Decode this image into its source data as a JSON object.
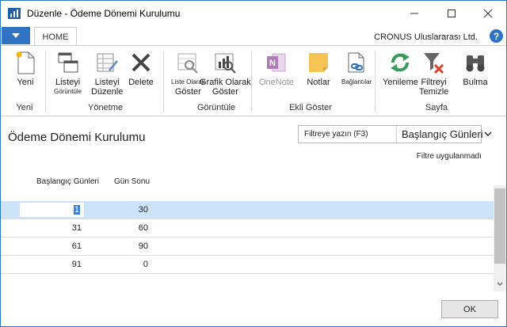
{
  "window": {
    "title": "Düzenle - Ödeme Dönemi Kurulumu",
    "company": "CRONUS Uluslararası Ltd."
  },
  "tabs": {
    "home": "HOME"
  },
  "ribbon": {
    "yeni": {
      "label": "Yeni",
      "group": "Yeni"
    },
    "yonetme": {
      "listeyi_goruntule": [
        "Listeyi",
        "Görüntüle"
      ],
      "listeyi_duzenle": [
        "Listeyi",
        "Düzenle"
      ],
      "delete": "Delete",
      "group": "Yönetme"
    },
    "goruntule": {
      "liste_olarak_goster": [
        "Liste Olarak",
        "Göster"
      ],
      "grafik_olarak_goster": [
        "Grafik Olarak",
        "Göster"
      ],
      "group": "Görüntüle"
    },
    "ekli_goster": {
      "onenote": "OneNote",
      "notlar": "Notlar",
      "baglantilar": "Bağlantılar",
      "group": "Ekli Göster"
    },
    "sayfa": {
      "yenileme": "Yenileme",
      "filtreyi_temizle": [
        "Filtreyi",
        "Temizle"
      ],
      "bulma": "Bulma",
      "group": "Sayfa"
    }
  },
  "page": {
    "title": "Ödeme Dönemi Kurulumu"
  },
  "filter": {
    "placeholder": "Filtreye yazın (F3)",
    "field": "Başlangıç Günleri",
    "status": "Filtre uygulanmadı"
  },
  "table": {
    "headers": [
      "Başlangıç Günleri",
      "Gün Sonu"
    ],
    "rows": [
      [
        "1",
        "30"
      ],
      [
        "31",
        "60"
      ],
      [
        "61",
        "90"
      ],
      [
        "91",
        "0"
      ]
    ]
  },
  "footer": {
    "ok": "OK"
  },
  "colors": {
    "accent": "#2f73c2",
    "selection": "#cde3f7",
    "window_border": "#2b79d0"
  }
}
